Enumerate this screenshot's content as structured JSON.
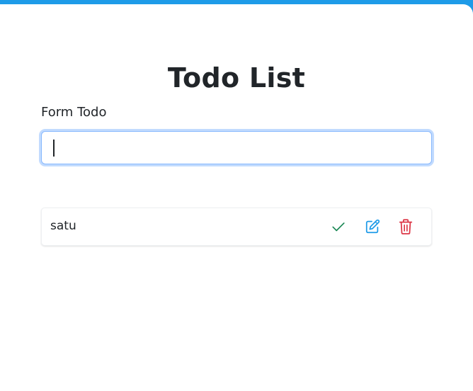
{
  "header": {
    "title": "Todo List"
  },
  "form": {
    "label": "Form Todo",
    "input_value": "",
    "input_placeholder": ""
  },
  "todos": [
    {
      "text": "satu",
      "actions": {
        "done_icon": "check-icon",
        "edit_icon": "edit-pencil-icon",
        "delete_icon": "trash-icon"
      }
    }
  ],
  "colors": {
    "accent_bar": "#1e9be8",
    "done": "#198754",
    "edit": "#0d6efd",
    "delete": "#dc3545"
  }
}
